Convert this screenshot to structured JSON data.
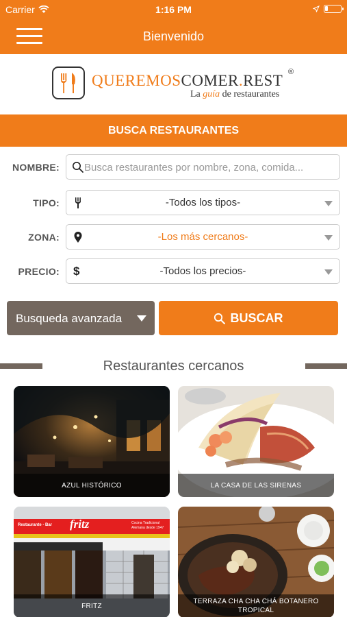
{
  "statusbar": {
    "carrier": "Carrier",
    "time": "1:16 PM",
    "battery_level": 0.2
  },
  "navbar": {
    "title": "Bienvenido",
    "menu_icon": "hamburger-icon"
  },
  "logo": {
    "title_part1": "QUEREMOS",
    "title_part2": "COMER",
    "title_dot": ".",
    "title_part3": "REST",
    "registered": "®",
    "subtitle_before": "La ",
    "subtitle_em": "guía",
    "subtitle_after": " de restaurantes"
  },
  "banner": {
    "title": "BUSCA RESTAURANTES"
  },
  "form": {
    "nombre": {
      "label": "NOMBRE:",
      "placeholder": "Busca restaurantes por nombre, zona, comida...",
      "value": ""
    },
    "tipo": {
      "label": "TIPO:",
      "value": "-Todos los tipos-"
    },
    "zona": {
      "label": "ZONA:",
      "value": "-Los más cercanos-"
    },
    "precio": {
      "label": "PRECIO:",
      "value": "-Todos los precios-",
      "icon_text": "$"
    }
  },
  "buttons": {
    "advanced": "Busqueda avanzada",
    "search": "BUSCAR"
  },
  "section": {
    "title": "Restaurantes cercanos"
  },
  "restaurants": [
    {
      "name": "AZUL HISTÓRICO"
    },
    {
      "name": "LA CASA DE LAS SIRENAS"
    },
    {
      "name": "FRITZ"
    },
    {
      "name": "TERRAZA CHA CHA CHÁ BOTANERO TROPICAL"
    }
  ],
  "fritz_sign": {
    "left": "Restaurante - Bar",
    "brand": "fritz",
    "right_line1": "Cocina Tradicional",
    "right_line2": "Alemana desde 1947"
  },
  "colors": {
    "accent": "#f07c1a",
    "secondary": "#73675e"
  }
}
